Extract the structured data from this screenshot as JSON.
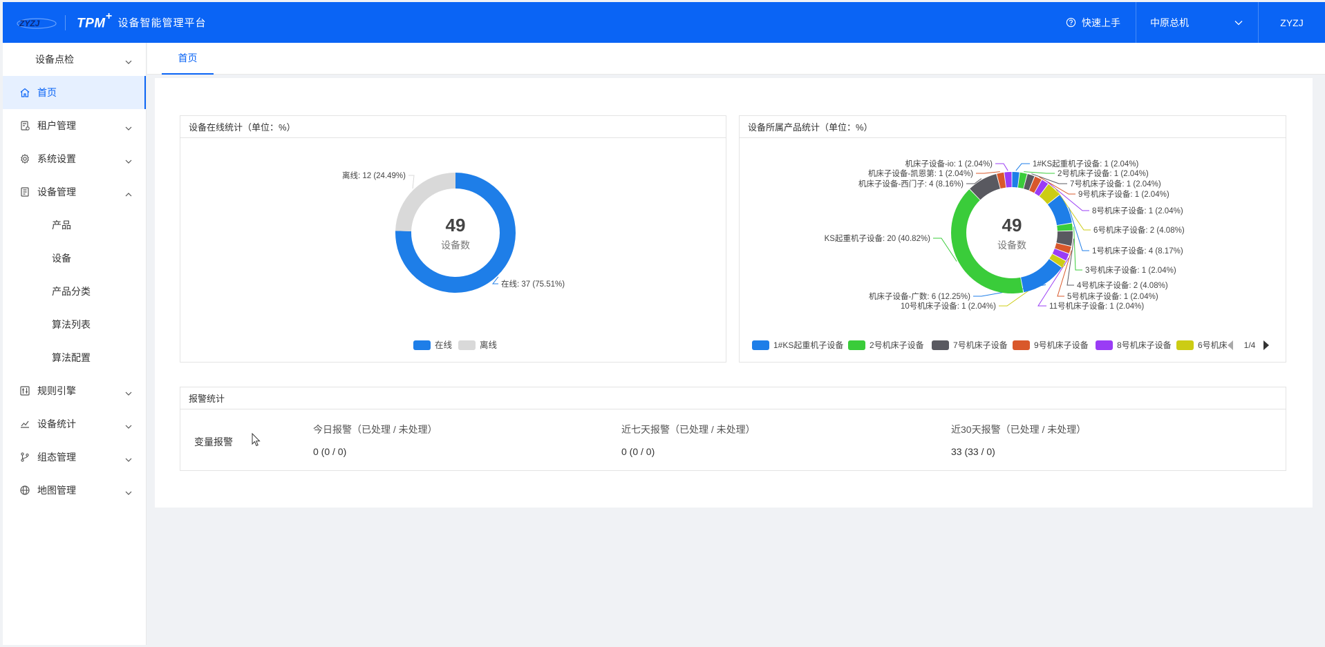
{
  "header": {
    "brand_name": "TPM",
    "brand_sup": "+",
    "brand_title": "设备智能管理平台",
    "quick_start": "快速上手",
    "org": "中原总机",
    "user": "ZYZJ"
  },
  "sidebar": {
    "items": [
      {
        "label": "设备点检",
        "icon": "none",
        "kind": "group",
        "expanded": false
      },
      {
        "label": "首页",
        "icon": "home-icon",
        "kind": "item",
        "active": true
      },
      {
        "label": "租户管理",
        "icon": "tenant-icon",
        "kind": "group",
        "expanded": false
      },
      {
        "label": "系统设置",
        "icon": "gear-icon",
        "kind": "group",
        "expanded": false
      },
      {
        "label": "设备管理",
        "icon": "device-icon",
        "kind": "group",
        "expanded": true
      },
      {
        "label": "产品",
        "kind": "sub"
      },
      {
        "label": "设备",
        "kind": "sub"
      },
      {
        "label": "产品分类",
        "kind": "sub"
      },
      {
        "label": "算法列表",
        "kind": "sub"
      },
      {
        "label": "算法配置",
        "kind": "sub"
      },
      {
        "label": "规则引擎",
        "icon": "rule-icon",
        "kind": "group",
        "expanded": false
      },
      {
        "label": "设备统计",
        "icon": "chart-icon",
        "kind": "group",
        "expanded": false
      },
      {
        "label": "组态管理",
        "icon": "branch-icon",
        "kind": "group",
        "expanded": false
      },
      {
        "label": "地图管理",
        "icon": "globe-icon",
        "kind": "group",
        "expanded": false
      }
    ]
  },
  "tabs": [
    {
      "label": "首页",
      "active": true
    }
  ],
  "online_panel": {
    "title": "设备在线统计（单位：%）",
    "center_value": "49",
    "center_label": "设备数"
  },
  "product_panel": {
    "title": "设备所属产品统计（单位：%）",
    "center_value": "49",
    "center_label": "设备数",
    "legend_page": "1/4"
  },
  "alarm_panel": {
    "title": "报警统计",
    "row_label": "变量报警",
    "columns": [
      {
        "title": "今日报警（已处理 / 未处理）",
        "value": "0 (0 / 0)"
      },
      {
        "title": "近七天报警（已处理 / 未处理）",
        "value": "0 (0 / 0)"
      },
      {
        "title": "近30天报警（已处理 / 未处理）",
        "value": "33 (33 / 0)"
      }
    ]
  },
  "colors": {
    "brand": "#0a64f5",
    "online": "#1e7ee8",
    "offline": "#d9d9d9"
  },
  "chart_data": [
    {
      "type": "pie",
      "donut": true,
      "total": 49,
      "series": [
        {
          "name": "在线",
          "value": 37,
          "label": "在线: 37 (75.51%)",
          "color": "#1e7ee8"
        },
        {
          "name": "离线",
          "value": 12,
          "label": "离线: 12 (24.49%)",
          "color": "#d9d9d9"
        }
      ],
      "legend": [
        "在线",
        "离线"
      ],
      "legend_position": "bottom"
    },
    {
      "type": "pie",
      "donut": true,
      "total": 49,
      "series": [
        {
          "name": "1#KS起重机子设备",
          "value": 1,
          "label": "1#KS起重机子设备: 1 (2.04%)",
          "color": "#1e7ee8"
        },
        {
          "name": "2号机床子设备",
          "value": 1,
          "label": "2号机床子设备: 1 (2.04%)",
          "color": "#3acc3a"
        },
        {
          "name": "7号机床子设备",
          "value": 1,
          "label": "7号机床子设备: 1 (2.04%)",
          "color": "#595960"
        },
        {
          "name": "9号机床子设备",
          "value": 1,
          "label": "9号机床子设备: 1 (2.04%)",
          "color": "#d9582b"
        },
        {
          "name": "8号机床子设备",
          "value": 1,
          "label": "8号机床子设备: 1 (2.04%)",
          "color": "#9a3cf5"
        },
        {
          "name": "6号机床子设备",
          "value": 2,
          "label": "6号机床子设备: 2 (4.08%)",
          "color": "#cccc14"
        },
        {
          "name": "1号机床子设备",
          "value": 4,
          "label": "1号机床子设备: 4 (8.17%)",
          "color": "#1e7ee8"
        },
        {
          "name": "3号机床子设备",
          "value": 1,
          "label": "3号机床子设备: 1 (2.04%)",
          "color": "#3acc3a"
        },
        {
          "name": "4号机床子设备",
          "value": 2,
          "label": "4号机床子设备: 2 (4.08%)",
          "color": "#595960"
        },
        {
          "name": "5号机床子设备",
          "value": 1,
          "label": "5号机床子设备: 1 (2.04%)",
          "color": "#d9582b"
        },
        {
          "name": "11号机床子设备",
          "value": 1,
          "label": "11号机床子设备: 1 (2.04%)",
          "color": "#9a3cf5"
        },
        {
          "name": "10号机床子设备",
          "value": 1,
          "label": "10号机床子设备: 1 (2.04%)",
          "color": "#cccc14"
        },
        {
          "name": "机床子设备-广数",
          "value": 6,
          "label": "机床子设备-广数: 6 (12.25%)",
          "color": "#1e7ee8"
        },
        {
          "name": "KS起重机子设备",
          "value": 20,
          "label": "KS起重机子设备: 20 (40.82%)",
          "color": "#3acc3a"
        },
        {
          "name": "机床子设备-西门子",
          "value": 4,
          "label": "机床子设备-西门子: 4 (8.16%)",
          "color": "#595960"
        },
        {
          "name": "机床子设备-凯恩第",
          "value": 1,
          "label": "机床子设备-凯恩第: 1 (2.04%)",
          "color": "#d9582b"
        },
        {
          "name": "机床子设备-io",
          "value": 1,
          "label": "机床子设备-io: 1 (2.04%)",
          "color": "#9a3cf5"
        }
      ],
      "legend": [
        {
          "name": "1#KS起重机子设备",
          "color": "#1e7ee8"
        },
        {
          "name": "2号机床子设备",
          "color": "#3acc3a"
        },
        {
          "name": "7号机床子设备",
          "color": "#595960"
        },
        {
          "name": "9号机床子设备",
          "color": "#d9582b"
        },
        {
          "name": "8号机床子设备",
          "color": "#9a3cf5"
        },
        {
          "name": "6号机床",
          "color": "#cccc14"
        }
      ],
      "legend_position": "bottom"
    }
  ]
}
